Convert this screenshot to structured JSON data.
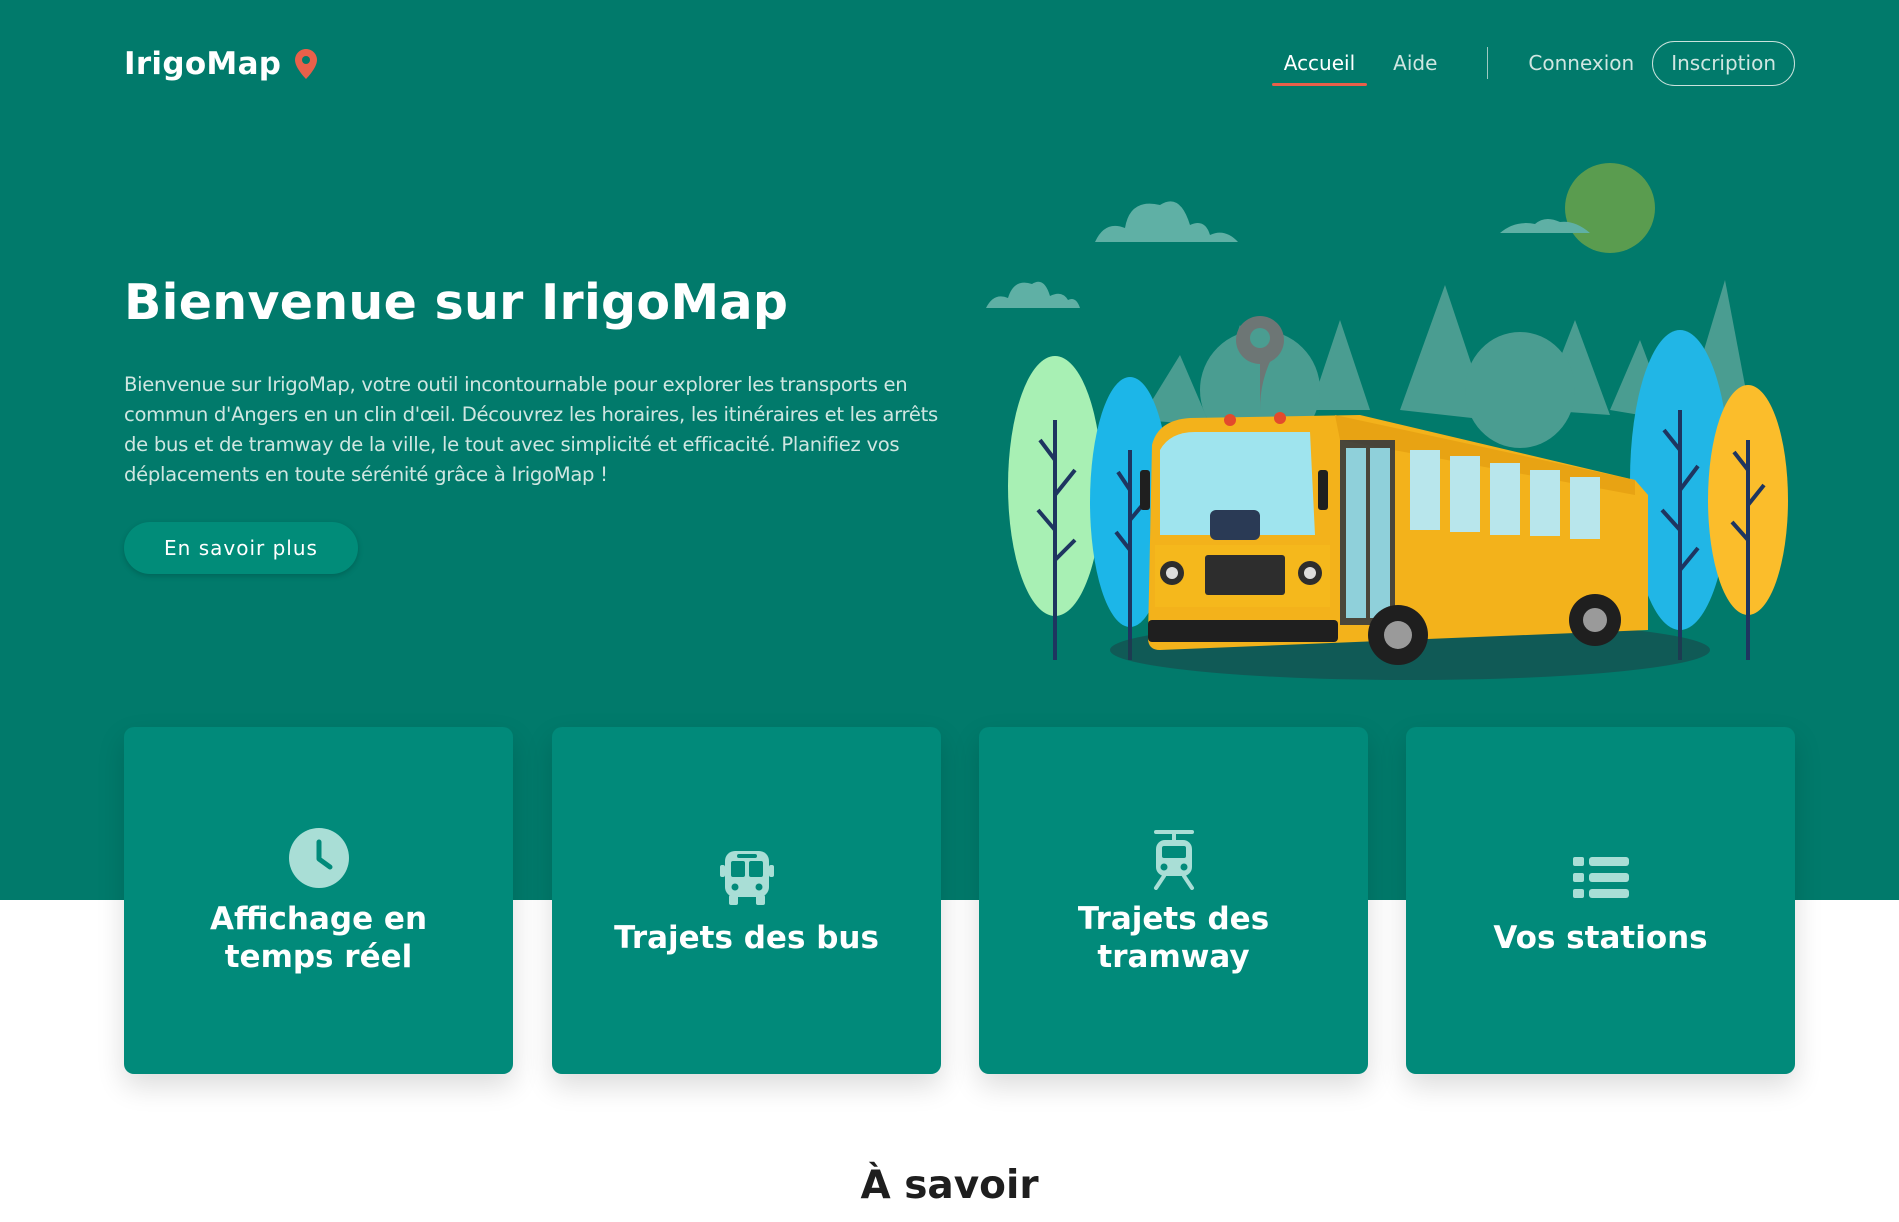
{
  "brand": {
    "name": "IrigoMap",
    "pin_icon": "map-pin-icon",
    "pin_color": "#e8604a"
  },
  "nav": {
    "links": [
      {
        "label": "Accueil",
        "active": true
      },
      {
        "label": "Aide",
        "active": false
      }
    ],
    "login": "Connexion",
    "signup": "Inscription"
  },
  "hero": {
    "title": "Bienvenue sur IrigoMap",
    "text": "Bienvenue sur IrigoMap, votre outil incontournable pour explorer les transports en commun d'Angers en un clin d'œil. Découvrez les horaires, les itinéraires et les arrêts de bus et de tramway de la ville, le tout avec simplicité et efficacité. Planifiez vos déplacements en toute sérénité grâce à IrigoMap !",
    "button": "En savoir plus",
    "illustration": "yellow-school-bus-with-trees-illustration"
  },
  "cards": [
    {
      "label": "Affichage en temps réel",
      "icon": "clock-icon"
    },
    {
      "label": "Trajets des bus",
      "icon": "bus-icon"
    },
    {
      "label": "Trajets des tramway",
      "icon": "tram-icon"
    },
    {
      "label": "Vos stations",
      "icon": "list-icon"
    }
  ],
  "section": {
    "title": "À savoir"
  },
  "colors": {
    "primary": "#017a6b",
    "card": "#018a7a",
    "accent": "#e8604a"
  }
}
